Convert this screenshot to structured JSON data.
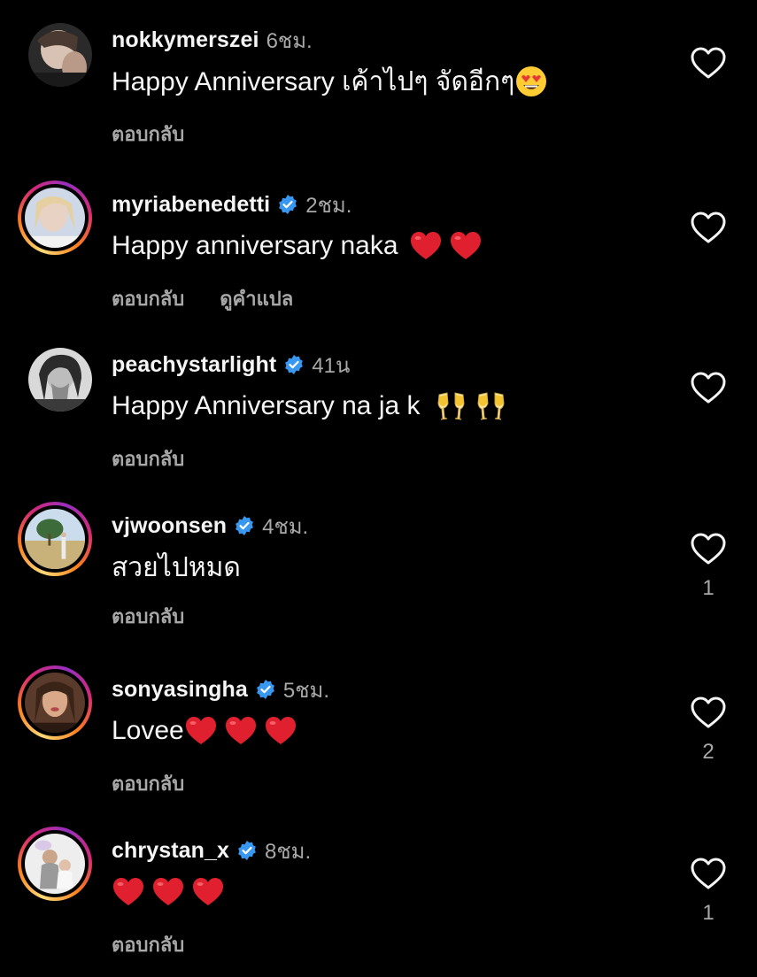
{
  "comments": [
    {
      "username": "nokkymerszei",
      "verified": false,
      "time": "6ชม.",
      "text": "Happy Anniversary เค้าไปๆ จัดอีกๆ",
      "emojis": [
        "heart-eyes"
      ],
      "reply_label": "ตอบกลับ",
      "translate_label": "",
      "like_count": ""
    },
    {
      "username": "myriabenedetti",
      "verified": true,
      "time": "2ชม.",
      "text": "Happy anniversary naka",
      "emojis": [
        "red-heart",
        "red-heart"
      ],
      "reply_label": "ตอบกลับ",
      "translate_label": "ดูคำแปล",
      "like_count": ""
    },
    {
      "username": "peachystarlight",
      "verified": true,
      "time": "41น",
      "text": "Happy Anniversary na ja k",
      "emojis": [
        "clinking-glasses",
        "clinking-glasses"
      ],
      "reply_label": "ตอบกลับ",
      "translate_label": "",
      "like_count": ""
    },
    {
      "username": "vjwoonsen",
      "verified": true,
      "time": "4ชม.",
      "text": "สวยไปหมด",
      "emojis": [],
      "reply_label": "ตอบกลับ",
      "translate_label": "",
      "like_count": "1"
    },
    {
      "username": "sonyasingha",
      "verified": true,
      "time": "5ชม.",
      "text": "Lovee",
      "emojis": [
        "red-heart",
        "red-heart",
        "red-heart"
      ],
      "reply_label": "ตอบกลับ",
      "translate_label": "",
      "like_count": "2"
    },
    {
      "username": "chrystan_x",
      "verified": true,
      "time": "8ชม.",
      "text": "",
      "emojis": [
        "red-heart",
        "red-heart",
        "red-heart"
      ],
      "reply_label": "ตอบกลับ",
      "translate_label": "",
      "like_count": "1"
    }
  ],
  "colors": {
    "background": "#000000",
    "primary_text": "#f5f5f5",
    "secondary_text": "#a8a8a8",
    "verified_badge": "#3897f0",
    "story_ring": [
      "#feda75",
      "#fa7e1e",
      "#d62976",
      "#962fbf"
    ]
  },
  "icons": {
    "like": "heart-outline-icon",
    "verified": "verified-badge-icon"
  }
}
